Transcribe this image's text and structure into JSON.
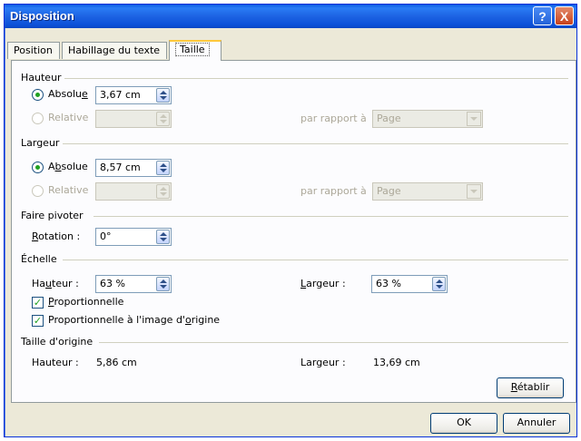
{
  "window": {
    "title": "Disposition"
  },
  "titlebar": {
    "help_glyph": "?",
    "close_glyph": "X"
  },
  "tabs": [
    {
      "label": "Position",
      "active": false
    },
    {
      "label": "Habillage du texte",
      "active": false
    },
    {
      "label": "Taille",
      "active": true
    }
  ],
  "height_section": {
    "title": "Hauteur",
    "absolute": {
      "label_pre": "Absolu",
      "label_accel": "e",
      "value": "3,67 cm",
      "selected": true
    },
    "relative": {
      "label": "Relative",
      "value": "",
      "enabled": false
    },
    "relative_to": {
      "label": "par rapport à",
      "value": "Page"
    }
  },
  "width_section": {
    "title": "Largeur",
    "absolute": {
      "label_pre": "A",
      "label_accel": "b",
      "label_post": "solue",
      "value": "8,57 cm",
      "selected": true
    },
    "relative": {
      "label": "Relative",
      "value": "",
      "enabled": false
    },
    "relative_to": {
      "label": "par rapport à",
      "value": "Page"
    }
  },
  "rotate_section": {
    "title": "Faire pivoter",
    "rotation": {
      "label_accel": "R",
      "label_post": "otation :",
      "value": "0°"
    }
  },
  "scale_section": {
    "title": "Échelle",
    "height": {
      "label_pre": "Ha",
      "label_accel": "u",
      "label_post": "teur :",
      "value": "63 %"
    },
    "width": {
      "label_accel": "L",
      "label_post": "argeur :",
      "value": "63 %"
    },
    "proportional": {
      "label_accel": "P",
      "label_post": "roportionnelle",
      "checked": true
    },
    "relative_original": {
      "label_pre": "Proportionnelle à l'image d'",
      "label_accel": "o",
      "label_post": "rigine",
      "checked": true
    }
  },
  "original_size": {
    "title": "Taille d'origine",
    "height_label": "Hauteur :",
    "height_value": "5,86 cm",
    "width_label": "Largeur :",
    "width_value": "13,69 cm",
    "reset": {
      "label_accel": "R",
      "label_post": "établir"
    }
  },
  "footer": {
    "ok_label": "OK",
    "cancel_label": "Annuler"
  },
  "colors": {
    "titlebar": "#0a5be2",
    "dialog_bg": "#ece9d8",
    "radio_dot": "#21a121"
  }
}
